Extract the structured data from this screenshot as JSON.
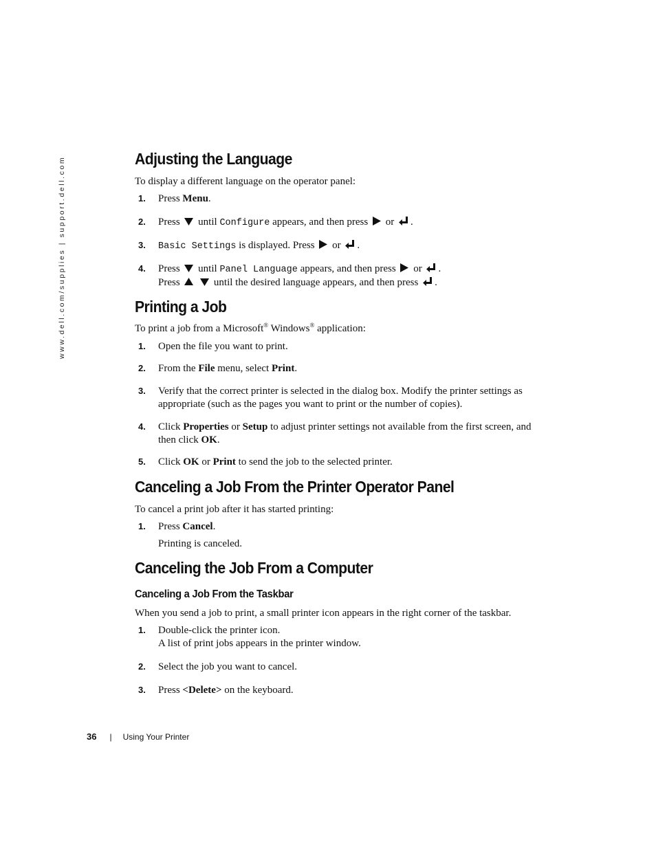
{
  "sidebar": {
    "url_text": "www.dell.com/supplies | support.dell.com"
  },
  "sections": {
    "language": {
      "title": "Adjusting the Language",
      "intro": "To display a different language on the operator panel:",
      "steps": [
        {
          "num": "1.",
          "pre": "Press ",
          "bold": "Menu",
          "post": "."
        },
        {
          "num": "2.",
          "pre": "Press",
          "mid1": "until",
          "code": "Configure",
          "mid2": "appears, and then press",
          "or": "or",
          "end": "."
        },
        {
          "num": "3.",
          "code": "Basic Settings",
          "mid": "is displayed. Press",
          "or": "or",
          "end": "."
        },
        {
          "num": "4.",
          "pre": "Press",
          "mid1": "until",
          "code": "Panel Language",
          "mid2": "appears, and then press",
          "or": "or",
          "end": ".",
          "line2_pre": "Press",
          "line2_mid": "until the desired language appears, and then press",
          "line2_end": "."
        }
      ]
    },
    "printing": {
      "title": "Printing a Job",
      "intro_pre": "To print a job from a Microsoft",
      "intro_mid": " Windows",
      "intro_post": " application:",
      "reg_mark": "®",
      "steps": [
        {
          "num": "1.",
          "text": "Open the file you want to print."
        },
        {
          "num": "2.",
          "pre": "From the ",
          "bold1": "File",
          "mid": " menu, select ",
          "bold2": "Print",
          "post": "."
        },
        {
          "num": "3.",
          "text": "Verify that the correct printer is selected in the dialog box. Modify the printer settings as appropriate (such as the pages you want to print or the number of copies)."
        },
        {
          "num": "4.",
          "pre": "Click ",
          "bold1": "Properties",
          "mid": " or ",
          "bold2": "Setup",
          "mid2": " to adjust printer settings not available from the first screen, and then click ",
          "bold3": "OK",
          "post": "."
        },
        {
          "num": "5.",
          "pre": "Click ",
          "bold1": "OK",
          "mid": " or ",
          "bold2": "Print",
          "post": " to send the job to the selected printer."
        }
      ]
    },
    "cancel_panel": {
      "title": "Canceling a Job From the Printer Operator Panel",
      "intro": "To cancel a print job after it has started printing:",
      "steps": [
        {
          "num": "1.",
          "pre": "Press ",
          "bold": "Cancel",
          "post": ".",
          "note": "Printing is canceled."
        }
      ]
    },
    "cancel_computer": {
      "title": "Canceling the Job From a Computer",
      "subtitle": "Canceling a Job From the Taskbar",
      "intro": "When you send a job to print, a small printer icon appears in the right corner of the taskbar.",
      "steps": [
        {
          "num": "1.",
          "text": "Double-click the printer icon.",
          "line2": "A list of print jobs appears in the printer window."
        },
        {
          "num": "2.",
          "text": "Select the job you want to cancel."
        },
        {
          "num": "3.",
          "pre": "Press ",
          "bold": "<Delete>",
          "post": " on the keyboard."
        }
      ]
    }
  },
  "footer": {
    "page_number": "36",
    "separator": "|",
    "chapter": "Using Your Printer"
  }
}
